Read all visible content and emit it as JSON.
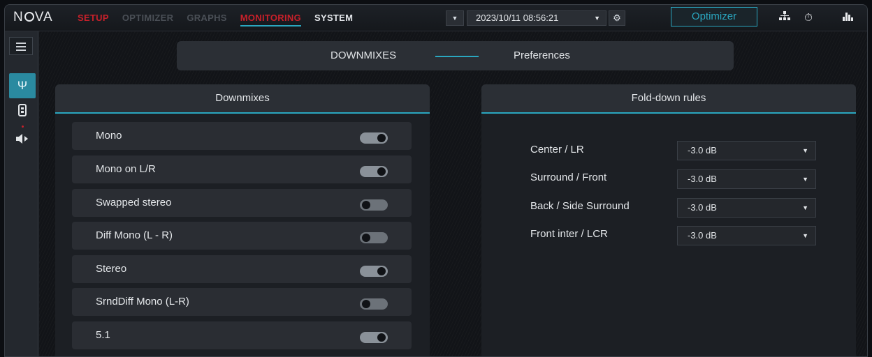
{
  "app": {
    "logo": "NOVA",
    "nav": [
      "SETUP",
      "OPTIMIZER",
      "GRAPHS",
      "MONITORING",
      "SYSTEM"
    ]
  },
  "toolbar": {
    "datetime": "2023/10/11 08:56:21",
    "optimizer_label": "Optimizer"
  },
  "tabs": {
    "downmixes": "DOWNMIXES",
    "preferences": "Preferences"
  },
  "downmixes": {
    "title": "Downmixes",
    "items": [
      {
        "label": "Mono",
        "on": true
      },
      {
        "label": "Mono on L/R",
        "on": true
      },
      {
        "label": "Swapped stereo",
        "on": false
      },
      {
        "label": "Diff Mono (L - R)",
        "on": false
      },
      {
        "label": "Stereo",
        "on": true
      },
      {
        "label": "SrndDiff Mono (L-R)",
        "on": false
      },
      {
        "label": "5.1",
        "on": true
      }
    ]
  },
  "folddown": {
    "title": "Fold-down rules",
    "rules": [
      {
        "label": "Center / LR",
        "value": "-3.0 dB"
      },
      {
        "label": "Surround / Front",
        "value": "-3.0 dB"
      },
      {
        "label": "Back / Side Surround",
        "value": "-3.0 dB"
      },
      {
        "label": "Front inter / LCR",
        "value": "-3.0 dB"
      }
    ]
  },
  "colors": {
    "accent": "#2aa7c0",
    "alert_red": "#c8202a"
  }
}
